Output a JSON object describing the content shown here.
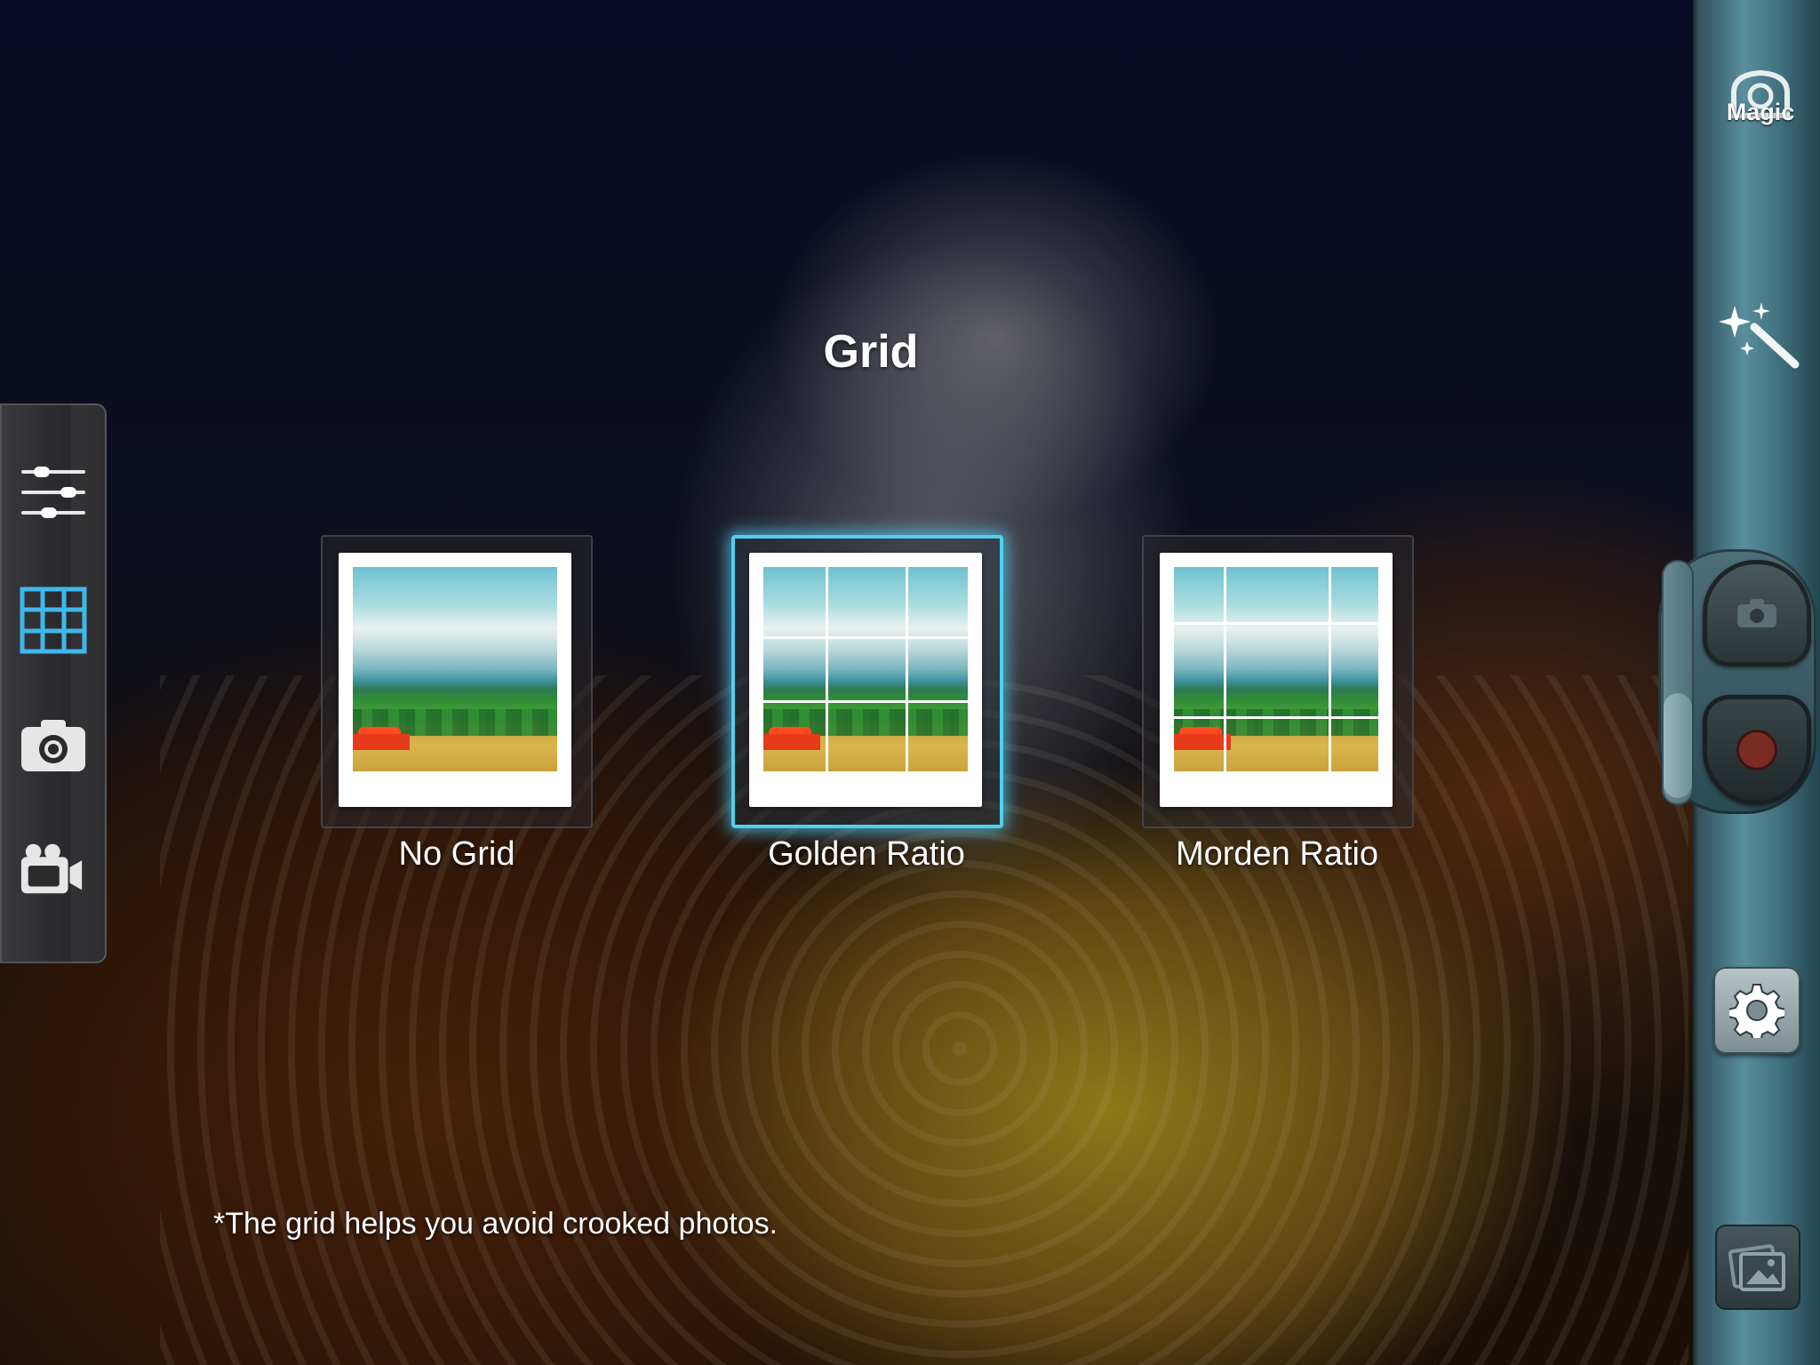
{
  "panel": {
    "title": "Grid",
    "hint": "*The grid helps you avoid crooked photos."
  },
  "grid_options": [
    {
      "label": "No Grid",
      "selected": false
    },
    {
      "label": "Golden Ratio",
      "selected": true
    },
    {
      "label": "Morden Ratio",
      "selected": false
    }
  ],
  "left_toolbar": {
    "items": [
      {
        "icon": "sliders-icon",
        "active": false
      },
      {
        "icon": "grid-icon",
        "active": true
      },
      {
        "icon": "camera-icon",
        "active": false
      },
      {
        "icon": "video-camera-icon",
        "active": false
      }
    ]
  },
  "right_bar": {
    "magic_label": "Magic",
    "icons": [
      "magic-wand-icon",
      "shutter-camera-icon",
      "record-icon",
      "gear-icon",
      "gallery-icon"
    ]
  },
  "colors": {
    "accent": "#4fd0ee",
    "active_tool": "#3fb8ea",
    "record": "#7a2c22"
  }
}
